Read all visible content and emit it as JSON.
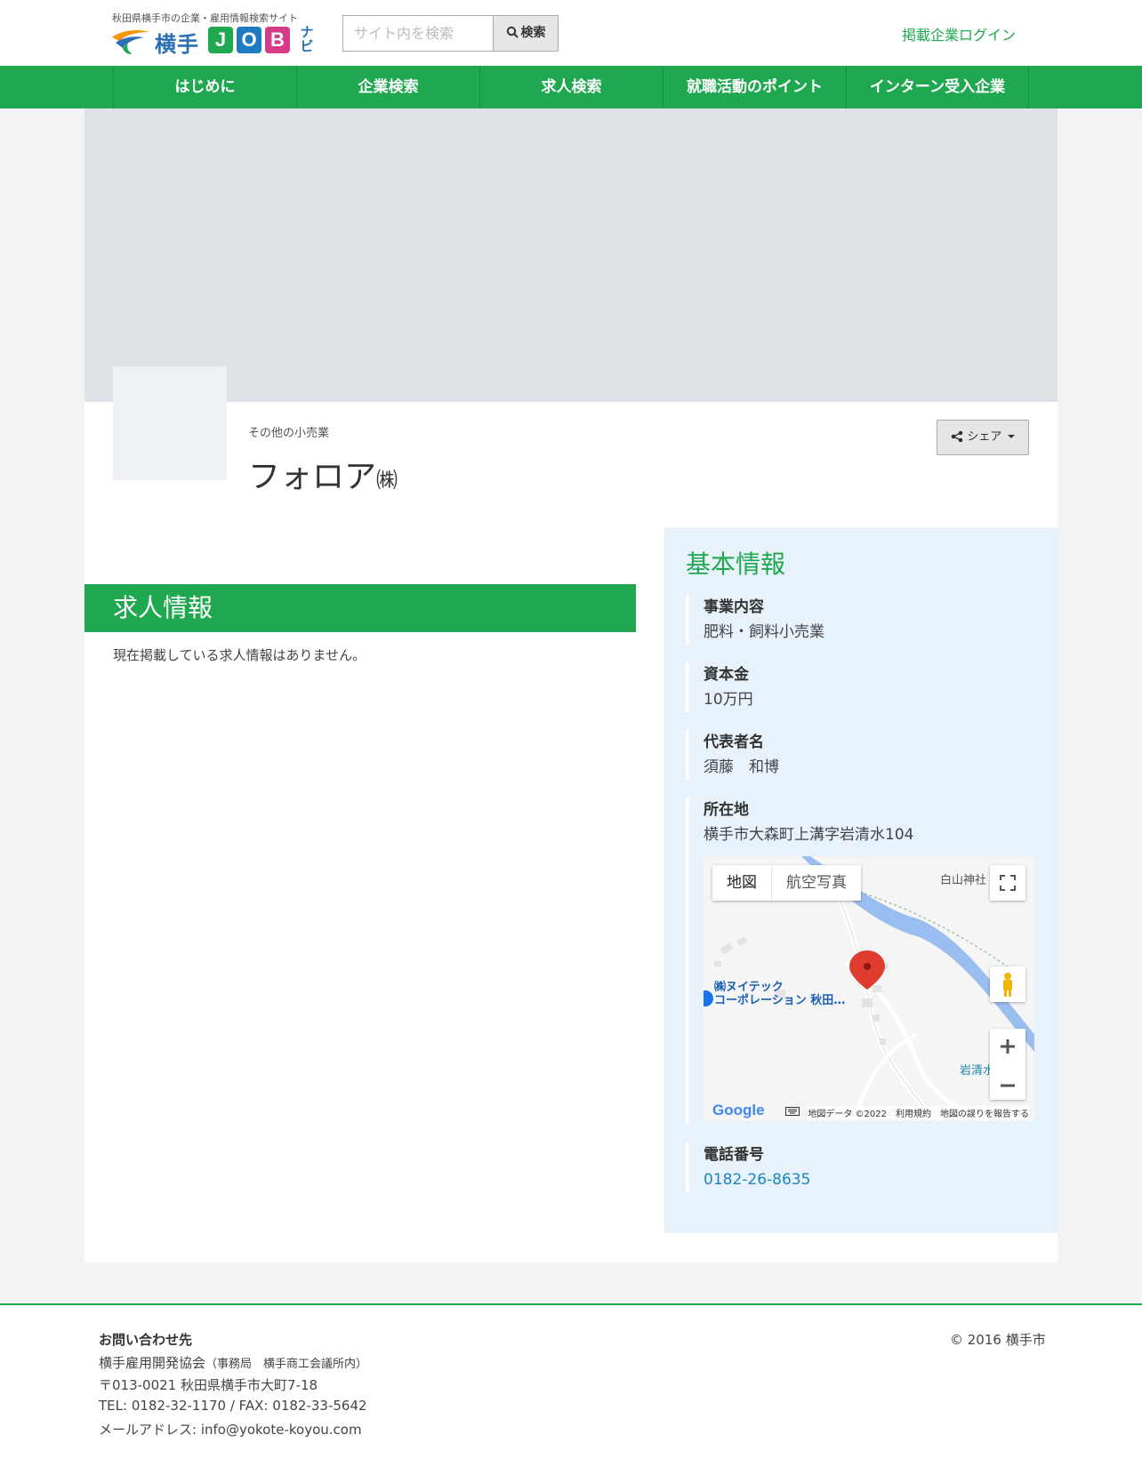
{
  "header": {
    "tagline": "秋田県横手市の企業・雇用情報検索サイト",
    "logo_text": "横手",
    "logo_tiles": [
      "J",
      "O",
      "B"
    ],
    "logo_suffix": "ナビ",
    "search_placeholder": "サイト内を検索",
    "search_button": "検索",
    "login_link": "掲載企業ログイン"
  },
  "nav": {
    "items": [
      {
        "label": "はじめに"
      },
      {
        "label": "企業検索"
      },
      {
        "label": "求人検索"
      },
      {
        "label": "就職活動のポイント"
      },
      {
        "label": "インターン受入企業"
      }
    ]
  },
  "company": {
    "category": "その他の小売業",
    "name": "フォロア",
    "name_suffix": "㈱",
    "share_button": "シェア"
  },
  "jobs": {
    "heading": "求人情報",
    "empty_message": "現在掲載している求人情報はありません。"
  },
  "info": {
    "title": "基本情報",
    "business": {
      "label": "事業内容",
      "value": "肥料・飼料小売業"
    },
    "capital": {
      "label": "資本金",
      "value": "10万円"
    },
    "representative": {
      "label": "代表者名",
      "value": "須藤　和博"
    },
    "address": {
      "label": "所在地",
      "value": "横手市大森町上溝字岩清水104"
    },
    "phone": {
      "label": "電話番号",
      "value": "0182-26-8635"
    }
  },
  "map": {
    "tab_map": "地図",
    "tab_satellite": "航空写真",
    "label_shrine": "白山神社",
    "label_company_line1": "㈱ヌイテック",
    "label_company_line2": "コーポレーション 秋田…",
    "label_iwashimizu": "岩清水",
    "logo": "Google",
    "attribution": "地図データ ©2022　利用規約　地図の誤りを報告する",
    "colors": {
      "river": "#9bbef0",
      "pin": "#e03b2f",
      "pegman": "#f5b400"
    }
  },
  "footer": {
    "contact_title": "お問い合わせ先",
    "org": "横手雇用開発協会",
    "org_note": "（事務局　横手商工会議所内）",
    "address": "〒013-0021 秋田県横手市大町7-18",
    "tel_fax": "TEL: 0182-32-1170 / FAX: 0182-33-5642",
    "email": "メールアドレス: info@yokote-koyou.com",
    "copyright": "© 2016 横手市"
  },
  "colors": {
    "accent": "#1fa84f",
    "info_bg": "#e7f2fa",
    "link": "#1a86c0"
  }
}
